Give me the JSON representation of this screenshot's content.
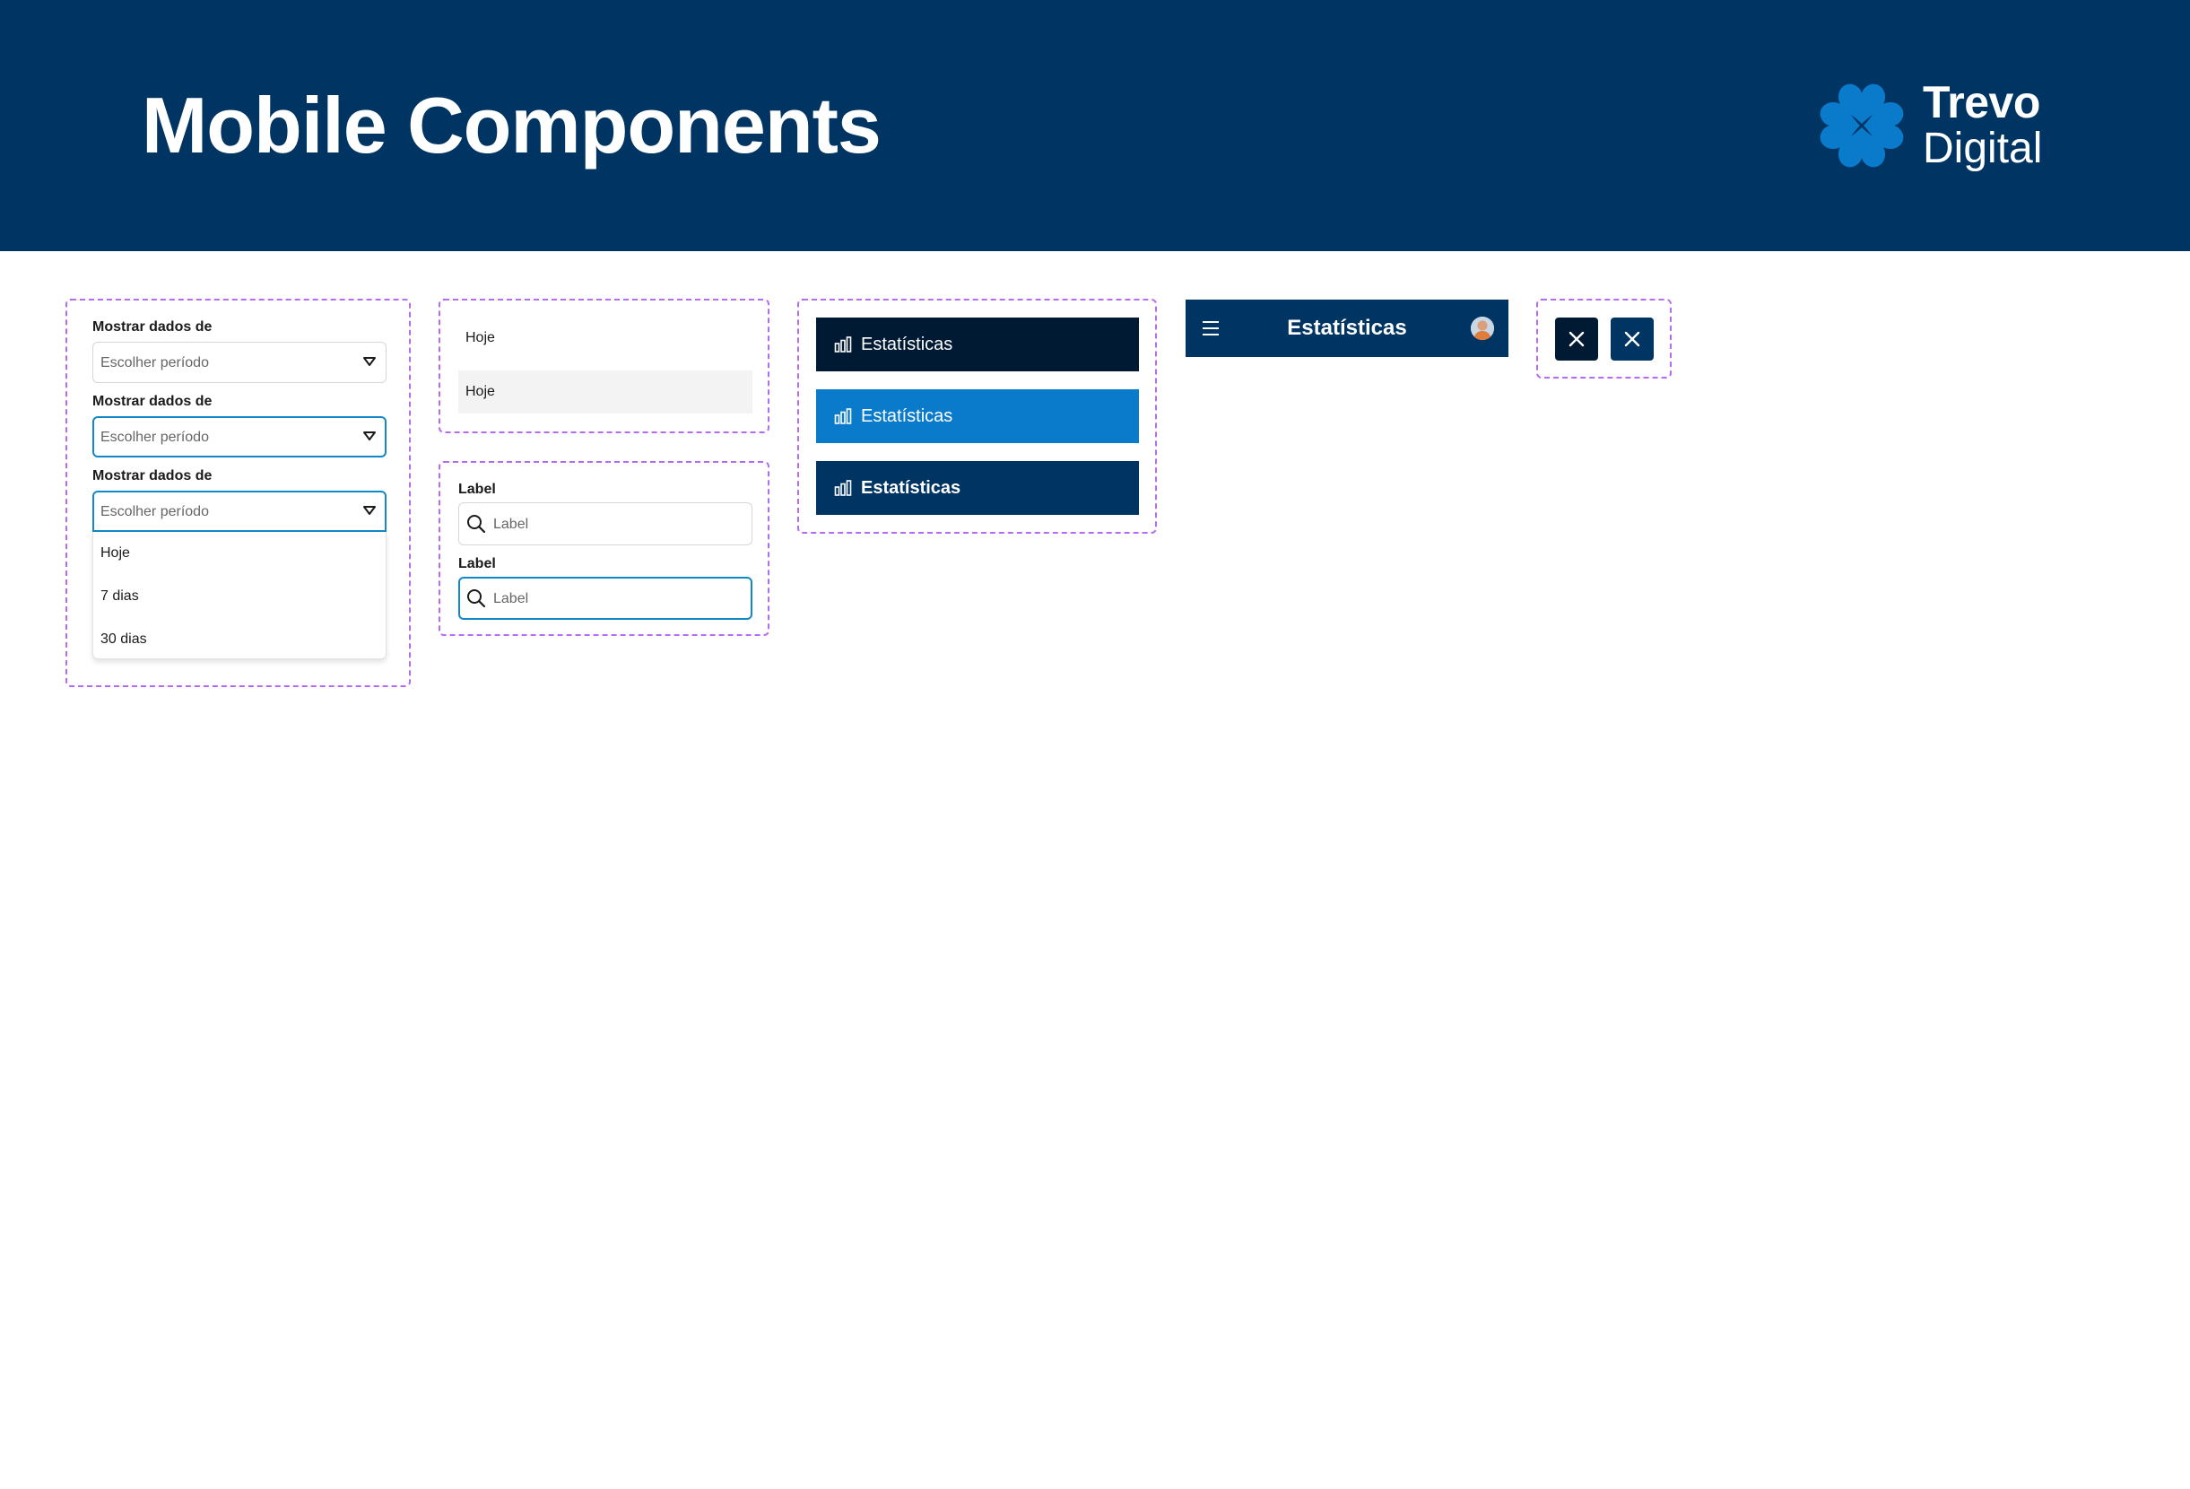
{
  "header": {
    "title": "Mobile Components",
    "logo": {
      "line1": "Trevo",
      "line2": "Digital",
      "icon": "clover-icon"
    }
  },
  "colors": {
    "header_bg": "#003462",
    "brand_blue": "#0A7ACB",
    "dark_navy": "#001A33",
    "focus_blue": "#1487C9",
    "frame_dashed": "#B66CF0"
  },
  "dropdowns": {
    "label": "Mostrar dados de",
    "placeholder": "Escolher período",
    "options": [
      "Hoje",
      "7 dias",
      "30 dias"
    ]
  },
  "list_items": [
    "Hoje",
    "Hoje"
  ],
  "search_fields": {
    "label": "Label",
    "placeholder": "Label"
  },
  "nav_buttons": [
    {
      "label": "Estatísticas",
      "icon": "bar-chart-icon",
      "state": "dark"
    },
    {
      "label": "Estatísticas",
      "icon": "bar-chart-icon",
      "state": "active"
    },
    {
      "label": "Estatísticas",
      "icon": "bar-chart-icon",
      "state": "bold"
    }
  ],
  "app_bar": {
    "title": "Estatísticas",
    "menu_icon": "hamburger-icon",
    "avatar": "avatar"
  },
  "close_buttons": [
    "close-icon",
    "close-icon"
  ]
}
